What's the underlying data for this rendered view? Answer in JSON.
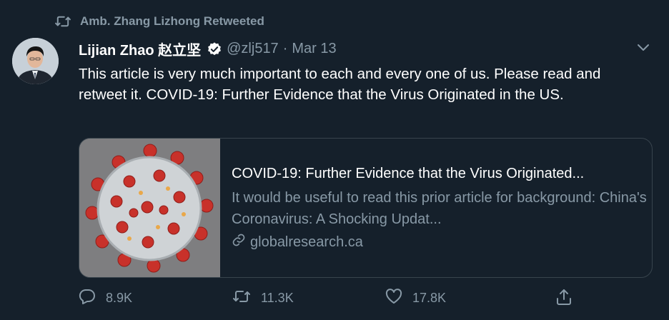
{
  "retweet_context": {
    "text": "Amb. Zhang Lizhong Retweeted",
    "icon": "retweet-icon"
  },
  "tweet": {
    "author_name": "Lijian Zhao 赵立坚",
    "verified": true,
    "handle": "@zlj517",
    "separator": "·",
    "date": "Mar 13",
    "text": "This article is very much important to each and every one of us. Please read and retweet it. COVID-19: Further Evidence that the Virus Originated in the US."
  },
  "card": {
    "title": "COVID-19: Further Evidence that the Virus Originated...",
    "description": "It would be useful to read this prior article for background: China's Coronavirus: A Shocking Updat...",
    "domain": "globalresearch.ca",
    "image": "coronavirus-illustration"
  },
  "actions": {
    "replies": "8.9K",
    "retweets": "11.3K",
    "likes": "17.8K"
  },
  "colors": {
    "background": "#15202b",
    "muted": "#8899a6",
    "border": "#38444d",
    "text": "#ffffff"
  }
}
